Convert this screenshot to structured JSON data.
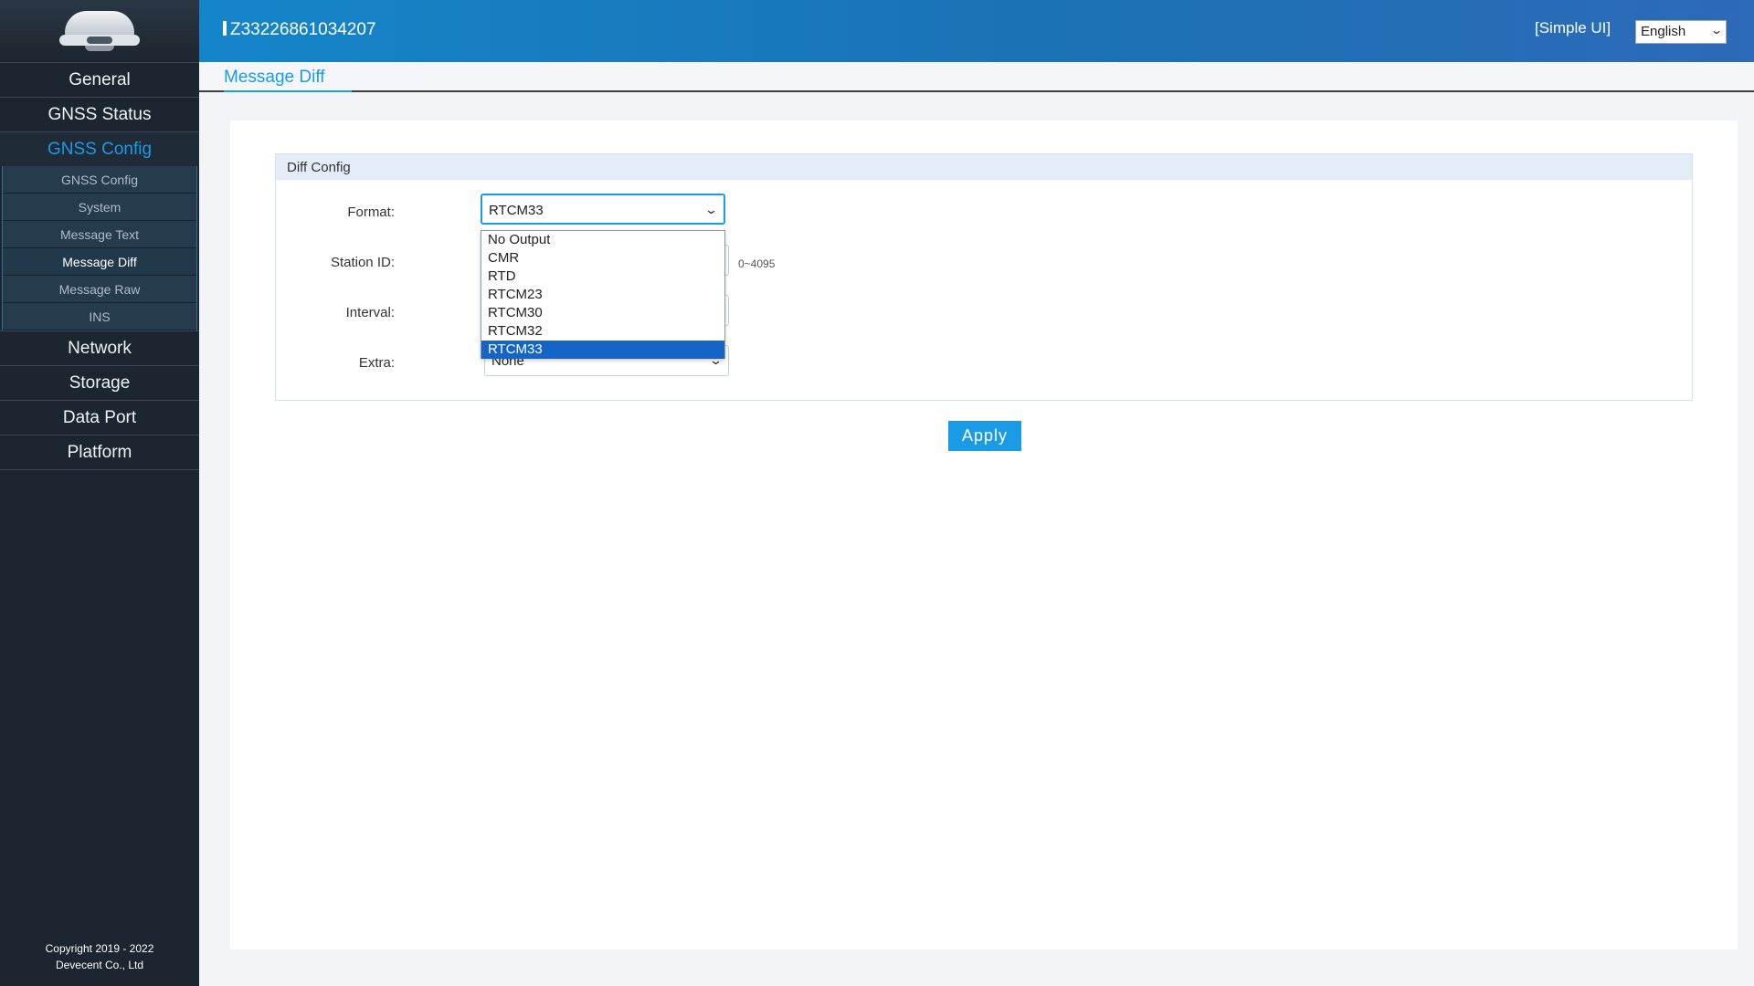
{
  "header": {
    "device_id": "Z33226861034207",
    "simple_ui_label": "[Simple UI]",
    "language": "English"
  },
  "sidebar": {
    "main_top": [
      {
        "label": "General"
      },
      {
        "label": "GNSS Status"
      },
      {
        "label": "GNSS Config"
      }
    ],
    "sub_items": [
      {
        "label": "GNSS Config"
      },
      {
        "label": "System"
      },
      {
        "label": "Message Text"
      },
      {
        "label": "Message Diff"
      },
      {
        "label": "Message Raw"
      },
      {
        "label": "INS"
      }
    ],
    "main_bottom": [
      {
        "label": "Network"
      },
      {
        "label": "Storage"
      },
      {
        "label": "Data Port"
      },
      {
        "label": "Platform"
      }
    ],
    "copyright_line1": "Copyright 2019 - 2022",
    "copyright_line2": "Devecent Co., Ltd"
  },
  "page": {
    "title": "Message Diff"
  },
  "diff_config": {
    "section_title": "Diff Config",
    "format_label": "Format:",
    "format_value": "RTCM33",
    "station_id_label": "Station ID:",
    "station_id_hint": "0~4095",
    "interval_label": "Interval:",
    "extra_label": "Extra:",
    "extra_value": "None",
    "format_options": [
      "No Output",
      "CMR",
      "RTD",
      "RTCM23",
      "RTCM30",
      "RTCM32",
      "RTCM33"
    ],
    "apply_label": "Apply"
  }
}
